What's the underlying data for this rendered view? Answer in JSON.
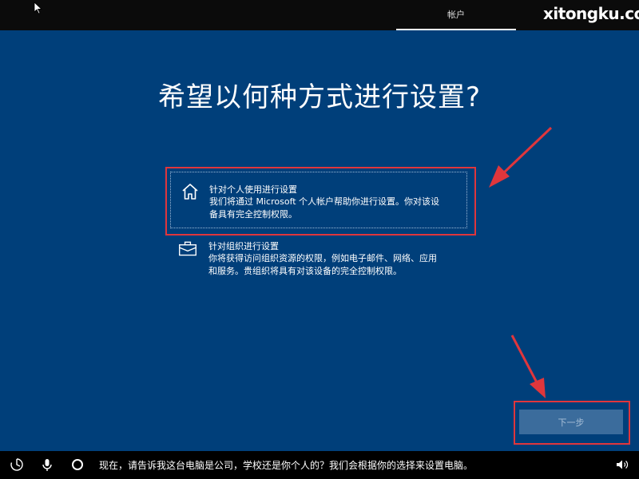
{
  "header": {
    "tab_label": "帐户",
    "brand": "xitongku.com"
  },
  "main": {
    "title": "希望以何种方式进行设置?",
    "options": [
      {
        "title": "针对个人使用进行设置",
        "desc_line1": "我们将通过 Microsoft 个人帐户帮助你进行设置。你对该设",
        "desc_line2": "备具有完全控制权限。",
        "icon": "home-icon",
        "selected": true
      },
      {
        "title": "针对组织进行设置",
        "desc_line1": "你将获得访问组织资源的权限，例如电子邮件、网络、应用",
        "desc_line2": "和服务。贵组织将具有对该设备的完全控制权限。",
        "icon": "briefcase-icon",
        "selected": false
      }
    ],
    "next_label": "下一步"
  },
  "statusbar": {
    "text": "现在，请告诉我这台电脑是公司，学校还是你个人的？我们会根据你的选择来设置电脑。",
    "icons": [
      "accessibility-icon",
      "microphone-icon",
      "cortana-circle-icon",
      "volume-icon"
    ]
  },
  "colors": {
    "background": "#003f7a",
    "highlight": "#e0363c",
    "next_button": "#3b6c9c"
  }
}
